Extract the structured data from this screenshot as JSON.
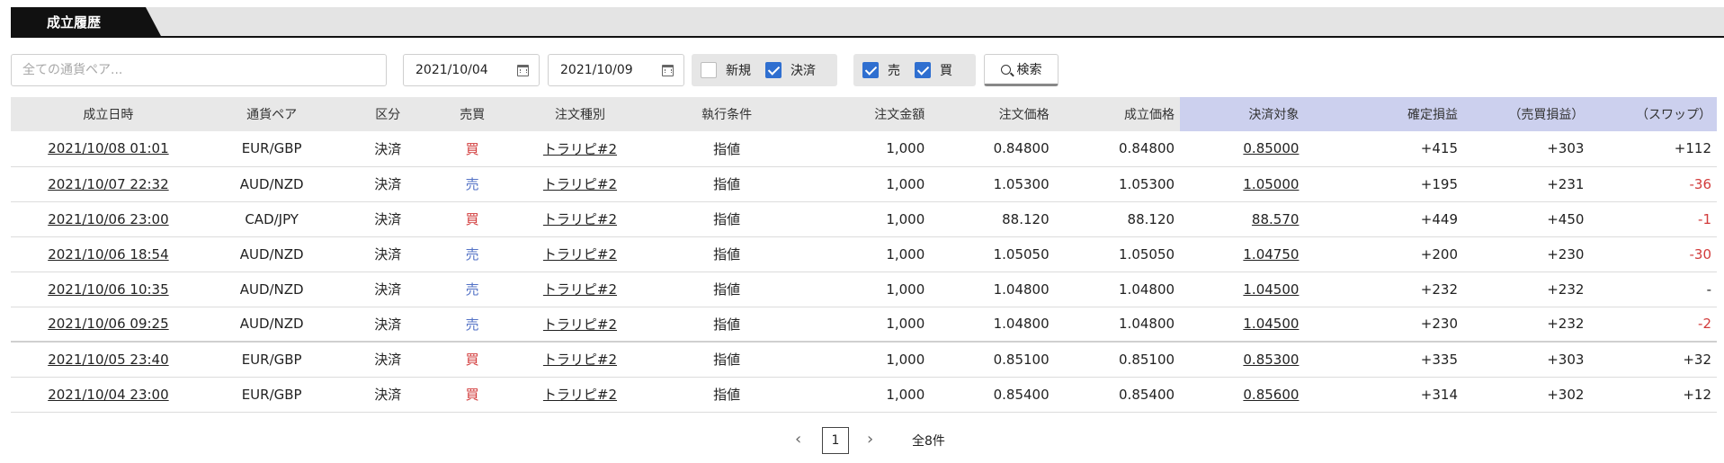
{
  "tab": {
    "label": "成立履歴"
  },
  "filters": {
    "search_placeholder": "全ての通貨ペア...",
    "date_from": "2021/10/04",
    "date_to": "2021/10/09",
    "type_new": "新規",
    "type_close": "決済",
    "side_sell": "売",
    "side_buy": "買",
    "search_button": "検索",
    "checked": {
      "new": false,
      "close": true,
      "sell": true,
      "buy": true
    }
  },
  "table": {
    "headers": [
      "成立日時",
      "通貨ペア",
      "区分",
      "売買",
      "注文種別",
      "執行条件",
      "注文金額",
      "注文価格",
      "成立価格",
      "決済対象",
      "確定損益",
      "（売買損益）",
      "（スワップ）"
    ],
    "rows": [
      [
        "2021/10/08 01:01",
        "EUR/GBP",
        "決済",
        "買",
        "トラリピ#2",
        "指値",
        "1,000",
        "0.84800",
        "0.84800",
        "0.85000",
        "+415",
        "+303",
        "+112"
      ],
      [
        "2021/10/07 22:32",
        "AUD/NZD",
        "決済",
        "売",
        "トラリピ#2",
        "指値",
        "1,000",
        "1.05300",
        "1.05300",
        "1.05000",
        "+195",
        "+231",
        "-36"
      ],
      [
        "2021/10/06 23:00",
        "CAD/JPY",
        "決済",
        "買",
        "トラリピ#2",
        "指値",
        "1,000",
        "88.120",
        "88.120",
        "88.570",
        "+449",
        "+450",
        "-1"
      ],
      [
        "2021/10/06 18:54",
        "AUD/NZD",
        "決済",
        "売",
        "トラリピ#2",
        "指値",
        "1,000",
        "1.05050",
        "1.05050",
        "1.04750",
        "+200",
        "+230",
        "-30"
      ],
      [
        "2021/10/06 10:35",
        "AUD/NZD",
        "決済",
        "売",
        "トラリピ#2",
        "指値",
        "1,000",
        "1.04800",
        "1.04800",
        "1.04500",
        "+232",
        "+232",
        "-"
      ],
      [
        "2021/10/06 09:25",
        "AUD/NZD",
        "決済",
        "売",
        "トラリピ#2",
        "指値",
        "1,000",
        "1.04800",
        "1.04800",
        "1.04500",
        "+230",
        "+232",
        "-2"
      ],
      [
        "2021/10/05 23:40",
        "EUR/GBP",
        "決済",
        "買",
        "トラリピ#2",
        "指値",
        "1,000",
        "0.85100",
        "0.85100",
        "0.85300",
        "+335",
        "+303",
        "+32"
      ],
      [
        "2021/10/04 23:00",
        "EUR/GBP",
        "決済",
        "買",
        "トラリピ#2",
        "指値",
        "1,000",
        "0.85400",
        "0.85400",
        "0.85600",
        "+314",
        "+302",
        "+12"
      ]
    ]
  },
  "pagination": {
    "prev": "‹",
    "current": "1",
    "next": "›",
    "total": "全8件"
  },
  "colors": {
    "buy": "#d23b3b",
    "sell": "#5372c6",
    "negative": "#d23b3b",
    "highlight_header": "#ccd0ee",
    "checkbox": "#2f6fd0"
  },
  "icons": {
    "calendar": "calendar-icon",
    "search": "search-icon",
    "checkbox": "check-icon"
  }
}
